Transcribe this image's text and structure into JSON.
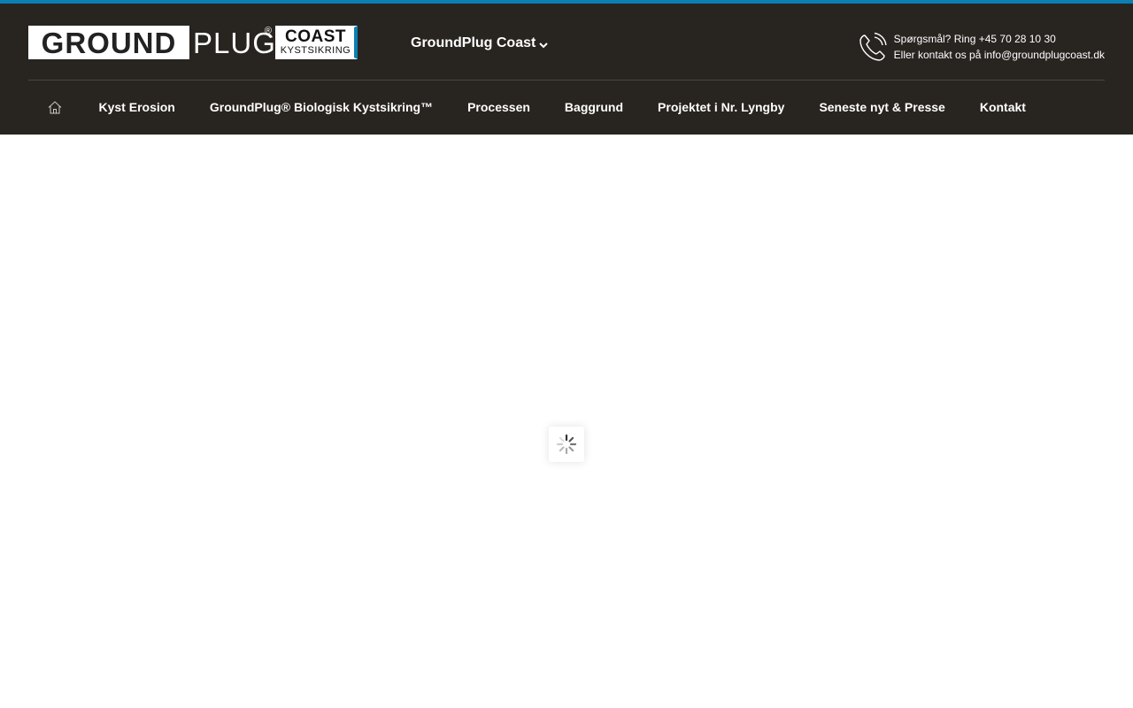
{
  "logo": {
    "ground": "GROUND",
    "plug": "PLUG",
    "registered": "®",
    "coast": "COAST",
    "kystsikring": "KYSTSIKRING"
  },
  "site_switch": {
    "label": "GroundPlug Coast",
    "icon": "chevron-down-icon"
  },
  "contact": {
    "icon": "phone-icon",
    "line1": "Spørgsmål? Ring +45 70 28 10 30",
    "line2": "Eller kontakt os på info@groundplugcoast.dk"
  },
  "nav": {
    "home_icon": "home-icon",
    "items": [
      {
        "label": "Kyst Erosion"
      },
      {
        "label": "GroundPlug® Biologisk Kystsikring™"
      },
      {
        "label": "Processen"
      },
      {
        "label": "Baggrund"
      },
      {
        "label": "Projektet i Nr. Lyngby"
      },
      {
        "label": "Seneste nyt & Presse"
      },
      {
        "label": "Kontakt"
      }
    ]
  },
  "loader": {
    "icon": "loading-spinner-icon"
  },
  "colors": {
    "header_bg": "#282420",
    "accent": "#0a80b5",
    "text": "#ffffff"
  }
}
